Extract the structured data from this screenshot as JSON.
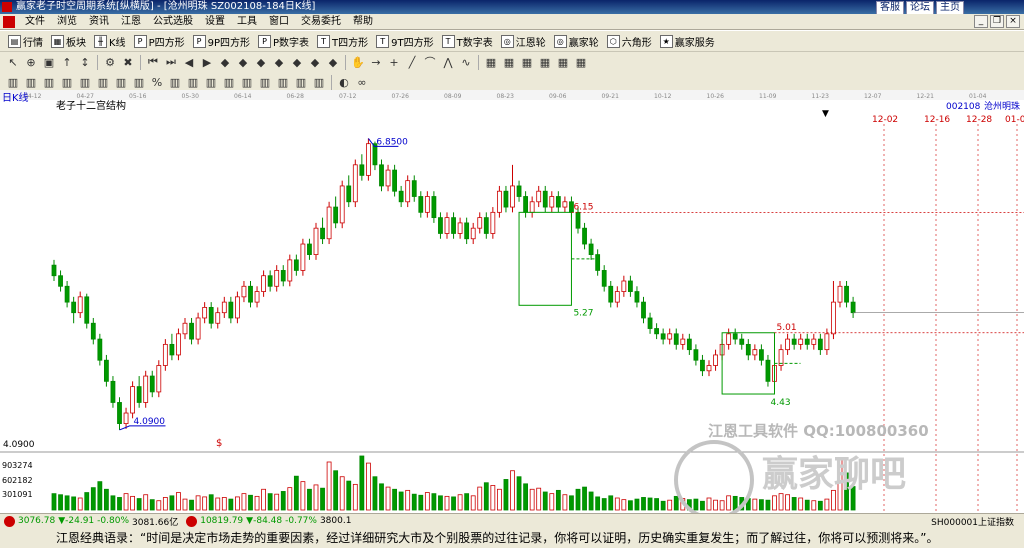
{
  "window": {
    "title": "赢家老子时空周期系统[纵横版] - [沧州明珠   SZ002108-184日K线]",
    "links": [
      "客服",
      "论坛",
      "主页"
    ]
  },
  "menu": [
    "文件",
    "浏览",
    "资讯",
    "江恩",
    "公式选股",
    "设置",
    "工具",
    "窗口",
    "交易委托",
    "帮助"
  ],
  "toolbar1": [
    "行情",
    "板块",
    "K线",
    "P四方形",
    "9P四方形",
    "P数字表",
    "T四方形",
    "9T四方形",
    "T数字表",
    "江恩轮",
    "赢家轮",
    "六角形",
    "赢家服务"
  ],
  "chart_header": {
    "period": "日K线",
    "indicator": "老子十二宫结构",
    "code": "002108",
    "name": "沧州明珠"
  },
  "chart_data": {
    "type": "candlestick",
    "title": "沧州明珠 002108 日K线",
    "x_ticks": [
      "04-12",
      "04-27",
      "05-16",
      "05-30",
      "06-14",
      "06-28",
      "07-12",
      "07-26",
      "08-09",
      "08-23",
      "09-06",
      "09-21",
      "10-12",
      "10-26",
      "11-09",
      "11-23",
      "12-07",
      "12-21",
      "01-04"
    ],
    "price_range": [
      3.9,
      7.1
    ],
    "annotations": [
      {
        "label": "6.8500",
        "value": 6.85,
        "type": "high"
      },
      {
        "label": "4.0900",
        "value": 4.09,
        "type": "low"
      },
      {
        "label": "6.15",
        "value": 6.15,
        "type": "level"
      },
      {
        "label": "5.27",
        "value": 5.27,
        "type": "level"
      },
      {
        "label": "5.01",
        "value": 5.01,
        "type": "level"
      },
      {
        "label": "4.43",
        "value": 4.43,
        "type": "level"
      }
    ],
    "price_axis_label": "4.0900",
    "future_dates": [
      "12-02",
      "12-16",
      "12-28",
      "01-0"
    ],
    "volume_axis": [
      "903274",
      "602182",
      "301091"
    ],
    "candles": [
      [
        5.65,
        5.55,
        5.7,
        5.5
      ],
      [
        5.55,
        5.45,
        5.6,
        5.4
      ],
      [
        5.45,
        5.3,
        5.5,
        5.25
      ],
      [
        5.3,
        5.2,
        5.35,
        5.1
      ],
      [
        5.2,
        5.35,
        5.4,
        5.15
      ],
      [
        5.35,
        5.1,
        5.38,
        5.05
      ],
      [
        5.1,
        4.95,
        5.15,
        4.9
      ],
      [
        4.95,
        4.75,
        5.0,
        4.7
      ],
      [
        4.75,
        4.55,
        4.8,
        4.5
      ],
      [
        4.55,
        4.35,
        4.6,
        4.3
      ],
      [
        4.35,
        4.15,
        4.4,
        4.09
      ],
      [
        4.15,
        4.25,
        4.3,
        4.1
      ],
      [
        4.25,
        4.5,
        4.55,
        4.2
      ],
      [
        4.5,
        4.35,
        4.6,
        4.3
      ],
      [
        4.35,
        4.6,
        4.65,
        4.3
      ],
      [
        4.6,
        4.45,
        4.65,
        4.4
      ],
      [
        4.45,
        4.7,
        4.75,
        4.4
      ],
      [
        4.7,
        4.9,
        4.95,
        4.65
      ],
      [
        4.9,
        4.8,
        5.0,
        4.75
      ],
      [
        4.8,
        5.0,
        5.05,
        4.75
      ],
      [
        5.0,
        5.1,
        5.15,
        4.95
      ],
      [
        5.1,
        4.95,
        5.15,
        4.9
      ],
      [
        4.95,
        5.15,
        5.2,
        4.9
      ],
      [
        5.15,
        5.25,
        5.3,
        5.1
      ],
      [
        5.25,
        5.1,
        5.3,
        5.05
      ],
      [
        5.1,
        5.2,
        5.25,
        5.05
      ],
      [
        5.2,
        5.3,
        5.35,
        5.15
      ],
      [
        5.3,
        5.15,
        5.35,
        5.1
      ],
      [
        5.15,
        5.35,
        5.4,
        5.1
      ],
      [
        5.35,
        5.45,
        5.5,
        5.3
      ],
      [
        5.45,
        5.3,
        5.5,
        5.25
      ],
      [
        5.3,
        5.4,
        5.45,
        5.25
      ],
      [
        5.4,
        5.55,
        5.6,
        5.35
      ],
      [
        5.55,
        5.45,
        5.6,
        5.4
      ],
      [
        5.45,
        5.6,
        5.65,
        5.4
      ],
      [
        5.6,
        5.5,
        5.65,
        5.45
      ],
      [
        5.5,
        5.7,
        5.75,
        5.45
      ],
      [
        5.7,
        5.6,
        5.75,
        5.55
      ],
      [
        5.6,
        5.85,
        5.9,
        5.55
      ],
      [
        5.85,
        5.75,
        5.9,
        5.7
      ],
      [
        5.75,
        6.0,
        6.05,
        5.7
      ],
      [
        6.0,
        5.9,
        6.1,
        5.85
      ],
      [
        5.9,
        6.2,
        6.25,
        5.85
      ],
      [
        6.2,
        6.05,
        6.3,
        6.0
      ],
      [
        6.05,
        6.4,
        6.45,
        6.0
      ],
      [
        6.4,
        6.25,
        6.5,
        6.2
      ],
      [
        6.25,
        6.6,
        6.65,
        6.2
      ],
      [
        6.6,
        6.5,
        6.7,
        6.45
      ],
      [
        6.5,
        6.8,
        6.85,
        6.45
      ],
      [
        6.8,
        6.6,
        6.82,
        6.55
      ],
      [
        6.6,
        6.4,
        6.65,
        6.35
      ],
      [
        6.4,
        6.55,
        6.6,
        6.35
      ],
      [
        6.55,
        6.35,
        6.6,
        6.3
      ],
      [
        6.35,
        6.25,
        6.4,
        6.2
      ],
      [
        6.25,
        6.45,
        6.5,
        6.2
      ],
      [
        6.45,
        6.3,
        6.5,
        6.25
      ],
      [
        6.3,
        6.15,
        6.35,
        6.1
      ],
      [
        6.15,
        6.3,
        6.35,
        6.1
      ],
      [
        6.3,
        6.1,
        6.35,
        6.05
      ],
      [
        6.1,
        5.95,
        6.15,
        5.9
      ],
      [
        5.95,
        6.1,
        6.15,
        5.9
      ],
      [
        6.1,
        5.95,
        6.15,
        5.9
      ],
      [
        5.95,
        6.05,
        6.1,
        5.9
      ],
      [
        6.05,
        5.9,
        6.1,
        5.85
      ],
      [
        5.9,
        6.0,
        6.05,
        5.85
      ],
      [
        6.0,
        6.1,
        6.15,
        5.95
      ],
      [
        6.1,
        5.95,
        6.15,
        5.9
      ],
      [
        5.95,
        6.15,
        6.2,
        5.9
      ],
      [
        6.15,
        6.35,
        6.4,
        6.1
      ],
      [
        6.35,
        6.2,
        6.4,
        6.15
      ],
      [
        6.2,
        6.4,
        6.6,
        6.15
      ],
      [
        6.4,
        6.3,
        6.45,
        6.25
      ],
      [
        6.3,
        6.15,
        6.35,
        6.1
      ],
      [
        6.15,
        6.25,
        6.3,
        6.1
      ],
      [
        6.25,
        6.35,
        6.4,
        6.2
      ],
      [
        6.35,
        6.2,
        6.4,
        6.15
      ],
      [
        6.2,
        6.3,
        6.35,
        6.15
      ],
      [
        6.3,
        6.2,
        6.35,
        6.15
      ],
      [
        6.2,
        6.25,
        6.3,
        6.15
      ],
      [
        6.25,
        6.15,
        6.3,
        6.1
      ],
      [
        6.15,
        6.0,
        6.2,
        5.95
      ],
      [
        6.0,
        5.85,
        6.05,
        5.8
      ],
      [
        5.85,
        5.75,
        5.9,
        5.7
      ],
      [
        5.75,
        5.6,
        5.8,
        5.55
      ],
      [
        5.6,
        5.45,
        5.65,
        5.4
      ],
      [
        5.45,
        5.3,
        5.5,
        5.25
      ],
      [
        5.3,
        5.4,
        5.45,
        5.25
      ],
      [
        5.4,
        5.5,
        5.55,
        5.35
      ],
      [
        5.5,
        5.4,
        5.55,
        5.35
      ],
      [
        5.4,
        5.3,
        5.45,
        5.25
      ],
      [
        5.3,
        5.15,
        5.35,
        5.1
      ],
      [
        5.15,
        5.05,
        5.2,
        5.0
      ],
      [
        5.05,
        5.0,
        5.1,
        4.95
      ],
      [
        5.0,
        4.95,
        5.05,
        4.9
      ],
      [
        4.95,
        5.0,
        5.05,
        4.9
      ],
      [
        5.0,
        4.9,
        5.05,
        4.85
      ],
      [
        4.9,
        4.95,
        5.0,
        4.85
      ],
      [
        4.95,
        4.85,
        5.0,
        4.8
      ],
      [
        4.85,
        4.75,
        4.9,
        4.7
      ],
      [
        4.75,
        4.65,
        4.8,
        4.6
      ],
      [
        4.65,
        4.7,
        4.75,
        4.6
      ],
      [
        4.7,
        4.8,
        4.85,
        4.65
      ],
      [
        4.8,
        4.9,
        4.95,
        4.75
      ],
      [
        4.9,
        5.0,
        5.05,
        4.85
      ],
      [
        5.0,
        4.95,
        5.05,
        4.9
      ],
      [
        4.95,
        4.9,
        5.0,
        4.85
      ],
      [
        4.9,
        4.8,
        4.95,
        4.75
      ],
      [
        4.8,
        4.85,
        4.9,
        4.75
      ],
      [
        4.85,
        4.75,
        4.9,
        4.7
      ],
      [
        4.75,
        4.55,
        4.8,
        4.5
      ],
      [
        4.55,
        4.7,
        4.75,
        4.5
      ],
      [
        4.7,
        4.85,
        4.9,
        4.65
      ],
      [
        4.85,
        4.95,
        5.0,
        4.8
      ],
      [
        4.95,
        4.9,
        5.0,
        4.85
      ],
      [
        4.9,
        4.95,
        5.0,
        4.85
      ],
      [
        4.95,
        4.9,
        5.0,
        4.85
      ],
      [
        4.9,
        4.95,
        5.0,
        4.85
      ],
      [
        4.95,
        4.85,
        5.0,
        4.8
      ],
      [
        4.85,
        5.0,
        5.05,
        4.8
      ],
      [
        5.0,
        5.3,
        5.5,
        4.95
      ],
      [
        5.3,
        5.45,
        5.5,
        5.25
      ],
      [
        5.45,
        5.3,
        5.5,
        5.25
      ],
      [
        5.3,
        5.2,
        5.35,
        5.15
      ]
    ],
    "volumes": [
      300,
      280,
      260,
      240,
      220,
      320,
      410,
      520,
      380,
      260,
      230,
      300,
      250,
      210,
      280,
      190,
      170,
      230,
      260,
      320,
      200,
      180,
      260,
      240,
      280,
      220,
      230,
      200,
      240,
      300,
      270,
      250,
      380,
      300,
      290,
      340,
      410,
      620,
      520,
      380,
      460,
      400,
      880,
      720,
      610,
      530,
      470,
      990,
      860,
      610,
      480,
      420,
      380,
      330,
      360,
      290,
      270,
      320,
      300,
      260,
      250,
      240,
      280,
      300,
      260,
      420,
      500,
      450,
      380,
      560,
      720,
      610,
      480,
      380,
      400,
      330,
      300,
      360,
      280,
      260,
      380,
      420,
      330,
      240,
      210,
      260,
      220,
      190,
      170,
      200,
      230,
      220,
      210,
      160,
      180,
      250,
      210,
      190,
      200,
      160,
      220,
      180,
      170,
      260,
      250,
      230,
      210,
      200,
      190,
      180,
      260,
      300,
      280,
      230,
      220,
      180,
      170,
      160,
      200,
      360,
      920,
      680,
      430,
      380
    ]
  },
  "status": {
    "index1_value": "3076.78",
    "index1_change": "▼-24.91",
    "index1_pct": "-0.80%",
    "index1_amount": "3081.66亿",
    "index2_value": "10819.79",
    "index2_change": "▼-84.48",
    "index2_pct": "-0.77%",
    "index2_amount": "3800.1",
    "right": "SH000001上证指数"
  },
  "watermark": {
    "line1": "江恩工具软件  QQ:100800360",
    "line2": "赢家聊吧"
  },
  "quote": "江恩经典语录：“时间是决定市场走势的重要因素，经过详细研究大市及个别股票的过往记录，你将可以证明，历史确实重复发生；而了解过往，你将可以预测将来。”。"
}
